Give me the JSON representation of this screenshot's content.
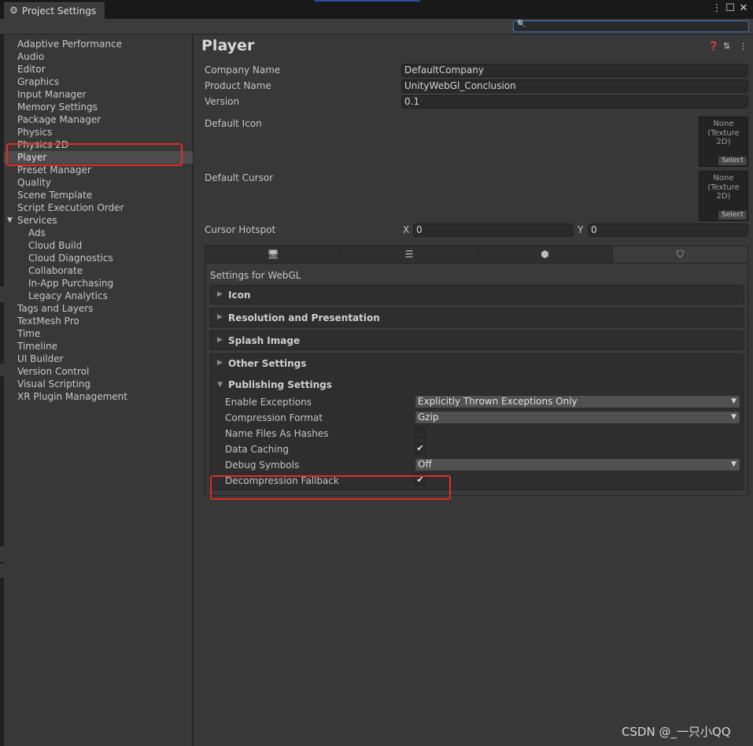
{
  "window": {
    "tab_title": "Project Settings",
    "tab_icon": "gear-icon",
    "controls": [
      "menu-icon",
      "maximize-icon",
      "close-icon"
    ]
  },
  "search": {
    "value": "",
    "placeholder": ""
  },
  "sidebar": {
    "items": [
      {
        "label": "Adaptive Performance"
      },
      {
        "label": "Audio"
      },
      {
        "label": "Editor"
      },
      {
        "label": "Graphics"
      },
      {
        "label": "Input Manager"
      },
      {
        "label": "Memory Settings"
      },
      {
        "label": "Package Manager"
      },
      {
        "label": "Physics"
      },
      {
        "label": "Physics 2D"
      },
      {
        "label": "Player",
        "selected": true
      },
      {
        "label": "Preset Manager"
      },
      {
        "label": "Quality"
      },
      {
        "label": "Scene Template"
      },
      {
        "label": "Script Execution Order"
      },
      {
        "label": "Services",
        "expanded": true
      },
      {
        "label": "Ads",
        "child": true
      },
      {
        "label": "Cloud Build",
        "child": true
      },
      {
        "label": "Cloud Diagnostics",
        "child": true
      },
      {
        "label": "Collaborate",
        "child": true
      },
      {
        "label": "In-App Purchasing",
        "child": true
      },
      {
        "label": "Legacy Analytics",
        "child": true
      },
      {
        "label": "Tags and Layers"
      },
      {
        "label": "TextMesh Pro"
      },
      {
        "label": "Time"
      },
      {
        "label": "Timeline"
      },
      {
        "label": "UI Builder"
      },
      {
        "label": "Version Control"
      },
      {
        "label": "Visual Scripting"
      },
      {
        "label": "XR Plugin Management"
      }
    ]
  },
  "player": {
    "title": "Player",
    "header_icons": [
      "help-icon",
      "preset-icon",
      "more-icon"
    ],
    "company_name_label": "Company Name",
    "company_name_value": "DefaultCompany",
    "product_name_label": "Product Name",
    "product_name_value": "UnityWebGl_Conclusion",
    "version_label": "Version",
    "version_value": "0.1",
    "default_icon_label": "Default Icon",
    "default_cursor_label": "Default Cursor",
    "texture_none": "None",
    "texture_type": "(Texture 2D)",
    "texture_select": "Select",
    "cursor_hotspot_label": "Cursor Hotspot",
    "hotspot_x_label": "X",
    "hotspot_x_value": "0",
    "hotspot_y_label": "Y",
    "hotspot_y_value": "0"
  },
  "platform_tabs": [
    {
      "icon": "monitor-icon",
      "glyph": "🖥"
    },
    {
      "icon": "server-icon",
      "glyph": "☰"
    },
    {
      "icon": "android-icon",
      "glyph": "⬢"
    },
    {
      "icon": "html5-icon",
      "glyph": "⛉",
      "active": true
    }
  ],
  "webgl": {
    "settings_for": "Settings for WebGL",
    "foldouts": [
      "Icon",
      "Resolution and Presentation",
      "Splash Image",
      "Other Settings"
    ],
    "publishing": {
      "title": "Publishing Settings",
      "enable_exceptions_label": "Enable Exceptions",
      "enable_exceptions_value": "Explicitly Thrown Exceptions Only",
      "compression_format_label": "Compression Format",
      "compression_format_value": "Gzip",
      "name_files_label": "Name Files As Hashes",
      "name_files_checked": false,
      "data_caching_label": "Data Caching",
      "data_caching_checked": true,
      "debug_symbols_label": "Debug Symbols",
      "debug_symbols_value": "Off",
      "decompression_fallback_label": "Decompression Fallback",
      "decompression_fallback_checked": true
    }
  },
  "colors": {
    "highlight": "#e32b26",
    "background": "#383838",
    "accent": "#3a79bb"
  },
  "watermark": "CSDN @_一只小QQ"
}
